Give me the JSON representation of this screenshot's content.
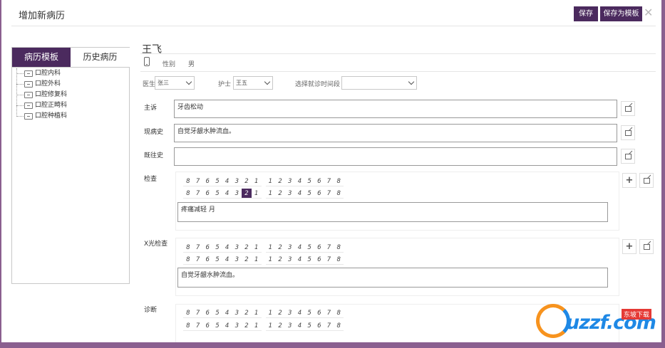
{
  "dialog": {
    "title": "增加新病历",
    "save_label": "保存",
    "save_template_label": "保存为模板",
    "close_glyph": "✕"
  },
  "tabs": [
    {
      "label": "病历模板",
      "active": true
    },
    {
      "label": "历史病历",
      "active": false
    }
  ],
  "tree": [
    "口腔内科",
    "口腔外科",
    "口腔修复科",
    "口腔正畸科",
    "口腔种植科"
  ],
  "patient": {
    "name": "王飞",
    "gender_label": "性别",
    "gender_value": "男"
  },
  "selectors": {
    "doctor_label": "医生",
    "doctor_value": "张三",
    "nurse_label": "护士",
    "nurse_value": "王五",
    "time_label": "选择就诊时间段",
    "time_value": ""
  },
  "fields": {
    "chief_label": "主诉",
    "chief_value": "牙齿松动",
    "present_label": "现病史",
    "present_value": "自觉牙龈水肿流血。",
    "past_label": "既往史",
    "past_value": "",
    "exam_label": "检查",
    "exam_value": "疼痛减轻 月",
    "xray_label": "X光检查",
    "xray_value": "自觉牙龈水肿流血。",
    "diag_label": "诊断"
  },
  "teeth": {
    "left": [
      "8",
      "7",
      "6",
      "5",
      "4",
      "3",
      "2",
      "1"
    ],
    "right": [
      "1",
      "2",
      "3",
      "4",
      "5",
      "6",
      "7",
      "8"
    ],
    "exam_selected_lower_left": "2"
  },
  "watermark": {
    "text": "uzzf.com",
    "badge": "东坡下载"
  },
  "colors": {
    "accent": "#4b2a5e",
    "frame": "#8a5f8f"
  }
}
